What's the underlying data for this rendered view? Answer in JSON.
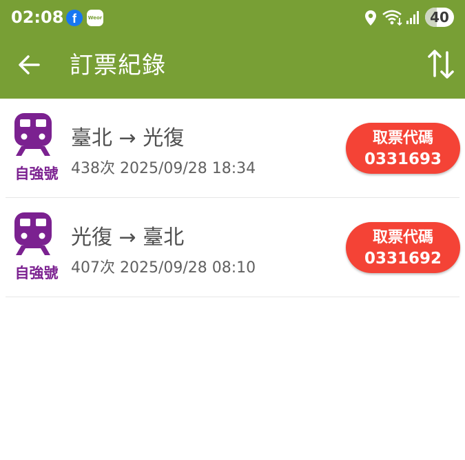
{
  "status_bar": {
    "time": "02:08",
    "notification_icons": [
      "facebook-icon",
      "app-icon"
    ],
    "app_icon_text": "Weor",
    "right_icons": [
      "location-icon",
      "wifi-icon",
      "signal-icon"
    ],
    "battery": "40",
    "battery_level": 0.4
  },
  "toolbar": {
    "title": "訂票紀錄",
    "back_icon": "arrow-left-icon",
    "sort_icon": "swap-vertical-icon"
  },
  "colors": {
    "app_bar": "#789f35",
    "train": "#7b2190",
    "pickup_button": "#f44336"
  },
  "bookings": [
    {
      "train_type": "自強號",
      "route": "臺北 → 光復",
      "detail": "438次 2025/09/28 18:34",
      "pickup_label": "取票代碼",
      "pickup_code": "0331693"
    },
    {
      "train_type": "自強號",
      "route": "光復 → 臺北",
      "detail": "407次 2025/09/28 08:10",
      "pickup_label": "取票代碼",
      "pickup_code": "0331692"
    }
  ]
}
